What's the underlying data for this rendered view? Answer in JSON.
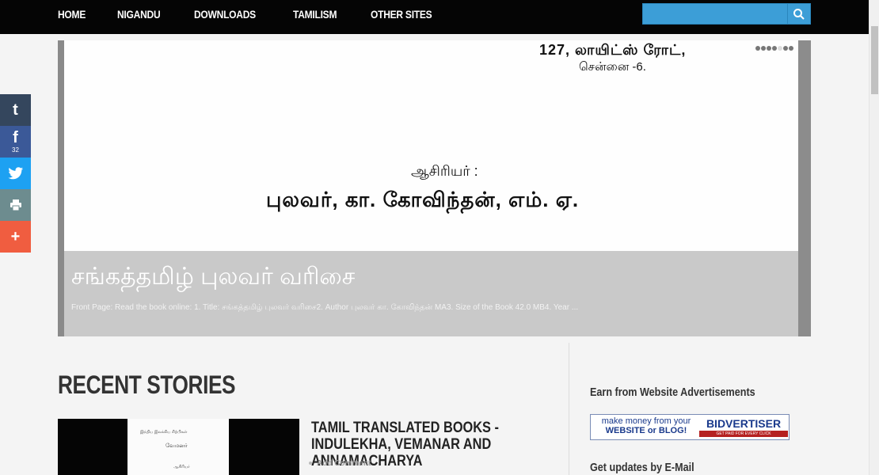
{
  "nav": {
    "items": [
      {
        "label": "HOME"
      },
      {
        "label": "NIGANDU"
      },
      {
        "label": "DOWNLOADS"
      },
      {
        "label": "TAMILISM"
      },
      {
        "label": "OTHER SITES"
      }
    ]
  },
  "search": {
    "placeholder": "",
    "icon": "search-icon"
  },
  "share": {
    "buttons": [
      {
        "icon": "tumblr-icon",
        "color": "#34465d"
      },
      {
        "icon": "facebook-icon",
        "color": "#3b5998",
        "count": "32"
      },
      {
        "icon": "twitter-icon",
        "color": "#1da1f2"
      },
      {
        "icon": "print-icon",
        "color": "#6d8c8f"
      },
      {
        "icon": "more-icon",
        "color": "#f05d40"
      }
    ]
  },
  "hero": {
    "scan_line1": "127, லாயிட்ஸ் ரோட்,",
    "scan_line2": "சென்னை -6.",
    "scan_author_label": "ஆசிரியர் :",
    "scan_author_name": "புலவர், கா. கோவிந்தன், எம். ஏ.",
    "title": "சங்கத்தமிழ் புலவர் வரிசை",
    "excerpt": "Front Page: Read the book online: 1. Title: சங்கத்தமிழ் புலவர் வரிசை2. Author புலவர் கா. கோவிந்தன் MA3. Size of the Book 42.0 MB4. Year ..."
  },
  "recent": {
    "heading": "RECENT STORIES",
    "story": {
      "title": "TAMIL TRANSLATED BOOKS - INDULEKHA, VEMANAR AND ANNAMACHARYA",
      "meta": "Add Comment",
      "thumb_t1": "இந்திய இலக்கிய சிற்பிகள்",
      "thumb_t2": "வேமனர்",
      "thumb_t3": "ஆசிரியர்"
    }
  },
  "sidebar": {
    "ad_title": "Earn from Website Advertisements",
    "ad_line1": "make money from your",
    "ad_line2": "WEBSITE or BLOG!",
    "ad_brand": "BIDVERTISER",
    "ad_sub": "GET PAID FOR EVERY CLICK",
    "updates_title": "Get updates by E-Mail"
  }
}
